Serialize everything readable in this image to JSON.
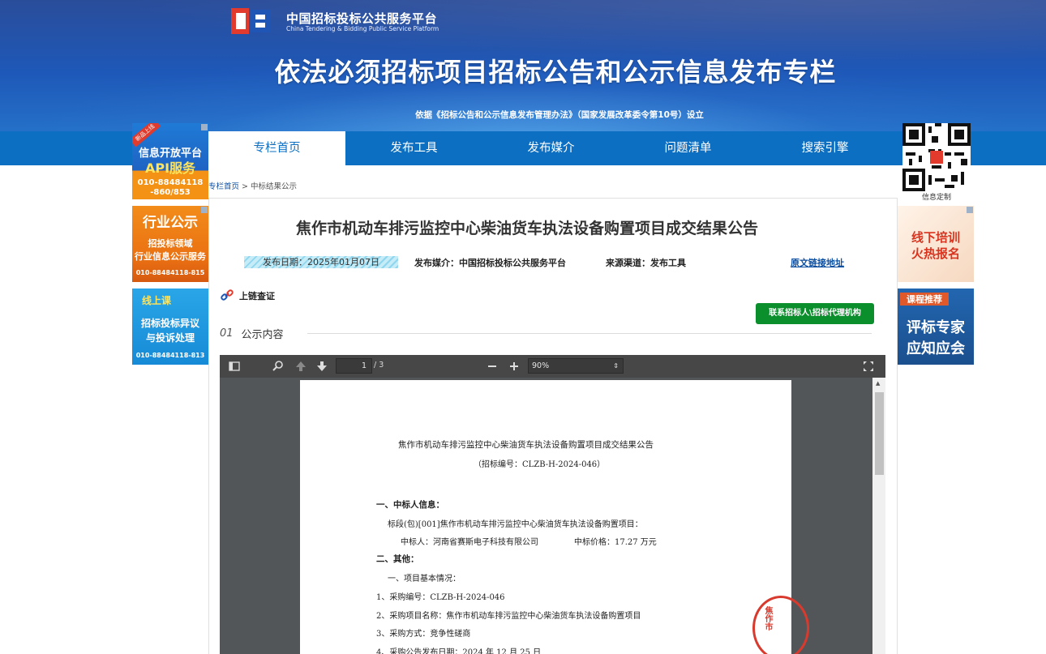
{
  "header": {
    "logo_cn": "中国招标投标公共服务平台",
    "logo_en": "China Tendering & Bidding Public Service Platform",
    "title": "依法必须招标项目招标公告和公示信息发布专栏",
    "subtitle": "依据《招标公告和公示信息发布管理办法》（国家发展改革委令第10号）设立"
  },
  "nav": {
    "items": [
      {
        "label": "专栏首页"
      },
      {
        "label": "发布工具"
      },
      {
        "label": "发布媒介"
      },
      {
        "label": "问题清单"
      },
      {
        "label": "搜索引擎"
      }
    ]
  },
  "left_ads": {
    "ad1": {
      "tag": "新品上线",
      "line1": "信息开放平台",
      "line2": "API服务",
      "phone": "010-88484118\n-860/853"
    },
    "ad2": {
      "line1": "行业公示",
      "line2": "招投标领域",
      "line3": "行业信息公示服务",
      "phone": "010-88484118-815"
    },
    "ad3": {
      "line1": "线上课",
      "line2": "招标投标异议",
      "line3": "与投诉处理",
      "phone": "010-88484118-813"
    }
  },
  "right_ads": {
    "qr_label": "信息定制",
    "ad1": {
      "line1": "线下培训",
      "line2": "火热报名"
    },
    "ad2": {
      "tag": "课程推荐",
      "line1": "评标专家",
      "line2": "应知应会"
    }
  },
  "breadcrumb": {
    "home": "专栏首页",
    "separator": ">",
    "current": "中标结果公示"
  },
  "article": {
    "title": "焦作市机动车排污监控中心柴油货车执法设备购置项目成交结果公告",
    "date_label": "发布日期：2025年01月07日",
    "media_label": "发布媒介：中国招标投标公共服务平台",
    "source_label": "来源渠道：发布工具",
    "original_link": "原文链接地址",
    "chain_label": "上链查证",
    "contact_button": "联系招标人\\招标代理机构",
    "section_num": "01",
    "section_title": "公示内容"
  },
  "viewer": {
    "page_current": "1",
    "page_total": "/ 3",
    "zoom": "90%",
    "doc": {
      "title": "焦作市机动车排污监控中心柴油货车执法设备购置项目成交结果公告",
      "code": "（招标编号：CLZB-H-2024-046）",
      "h1": "一、中标人信息：",
      "l1": "标段(包)[001]焦作市机动车排污监控中心柴油货车执法设备购置项目：",
      "l2a": "中标人：河南省赛斯电子科技有限公司",
      "l2b": "中标价格：17.27 万元",
      "h2": "二、其他：",
      "l3": "一、项目基本情况：",
      "l4": "1、采购编号：CLZB-H-2024-046",
      "l5": "2、采购项目名称：焦作市机动车排污监控中心柴油货车执法设备购置项目",
      "l6": "3、采购方式：竞争性磋商",
      "l7": "4、采购公告发布日期：2024 年 12 月 25 日",
      "stamp": "焦作市"
    }
  },
  "colors": {
    "nav_bg": "#0d6fc1",
    "contact_green": "#0b8e2c",
    "link_blue": "#0d4fa0",
    "viewer_toolbar": "#474747",
    "stamp_red": "#d83a2e"
  }
}
